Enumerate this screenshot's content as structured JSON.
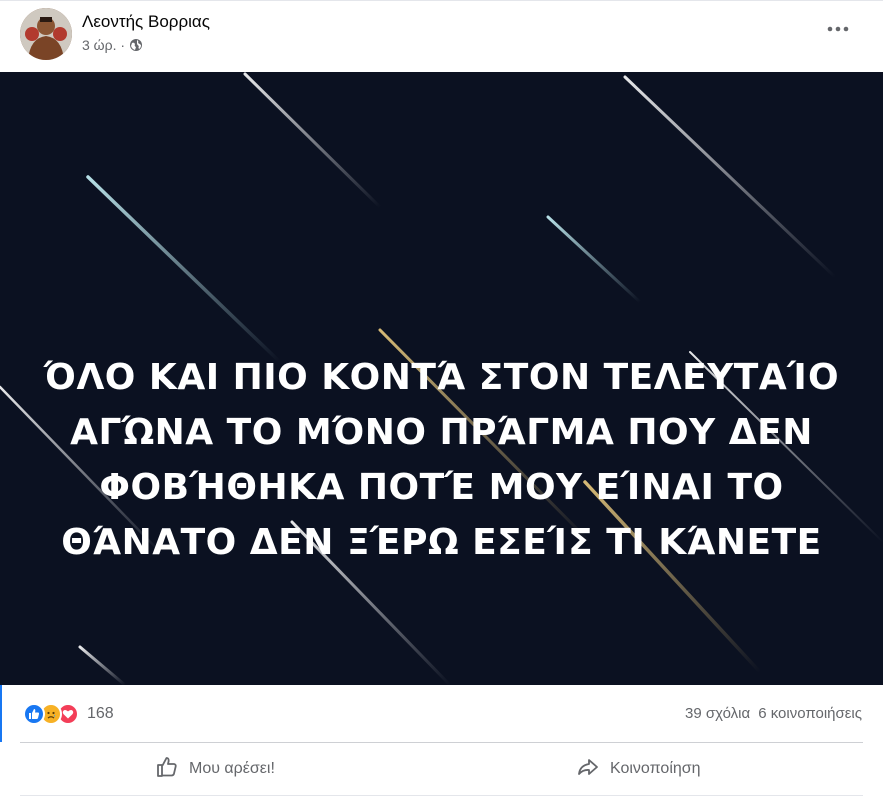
{
  "post": {
    "author": "Λεοντής Βορριας",
    "time": "3 ώρ. ·",
    "privacy_icon": "globe-icon",
    "more_icon": "more-horizontal-icon",
    "banner_text": [
      "ΌΛΟ ΚΑΙ ΠΙΟ ΚΟΝΤΆ ΣΤΟΝ ΤΕΛΕΥΤΑΊΟ",
      "ΑΓΏΝΑ ΤΟ ΜΌΝΟ ΠΡΆΓΜΑ ΠΟΥ ΔΕΝ",
      "ΦΟΒΉΘΗΚΑ ΠΟΤΈ ΜΟΥ ΕΊΝΑΙ ΤΟ",
      "ΘΆΝΑΤΟ ΔΕΝ ΞΈΡΩ ΕΣΕΊΣ ΤΙ ΚΆΝΕΤΕ"
    ],
    "banner_background": "#0b1121"
  },
  "stats": {
    "reaction_icons": [
      "like-icon",
      "sad-icon",
      "love-icon"
    ],
    "reaction_count": "168",
    "comments": "39 σχόλια",
    "shares": "6 κοινοποιήσεις"
  },
  "actions": {
    "like_label": "Μου αρέσει!",
    "share_label": "Κοινοποίηση"
  },
  "colors": {
    "accent": "#1877f2",
    "secondary_text": "#65676b",
    "sad": "#f7b125",
    "love": "#f33e58"
  }
}
